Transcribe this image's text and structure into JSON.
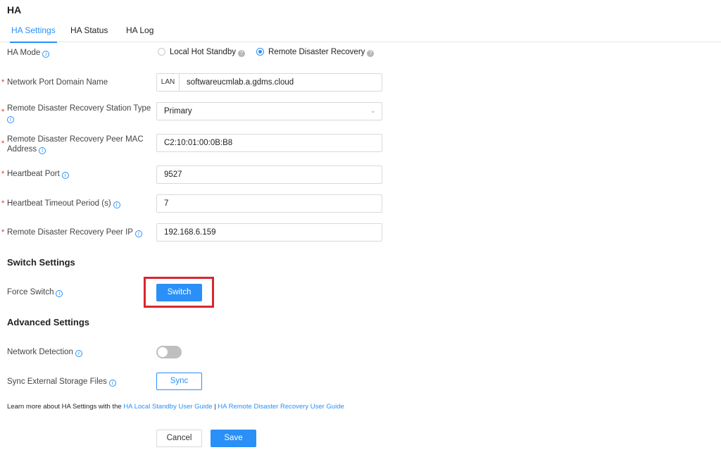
{
  "page": {
    "title": "HA"
  },
  "tabs": [
    {
      "label": "HA Settings",
      "active": true
    },
    {
      "label": "HA Status",
      "active": false
    },
    {
      "label": "HA Log",
      "active": false
    }
  ],
  "ha_mode": {
    "label": "HA Mode",
    "options": [
      {
        "label": "Local Hot Standby",
        "checked": false
      },
      {
        "label": "Remote Disaster Recovery",
        "checked": true
      }
    ]
  },
  "fields": {
    "domain_name": {
      "label": "Network Port Domain Name",
      "addon": "LAN",
      "value": "softwareucmlab.a.gdms.cloud"
    },
    "station_type": {
      "label": "Remote Disaster Recovery Station Type",
      "value": "Primary"
    },
    "peer_mac": {
      "label_line1": "Remote Disaster Recovery Peer MAC",
      "label_line2": "Address",
      "value": "C2:10:01:00:0B:B8"
    },
    "heartbeat_port": {
      "label": "Heartbeat Port",
      "value": "9527"
    },
    "heartbeat_timeout": {
      "label": "Heartbeat Timeout Period (s)",
      "value": "7"
    },
    "peer_ip": {
      "label": "Remote Disaster Recovery Peer IP",
      "value": "192.168.6.159"
    }
  },
  "switch_settings": {
    "title": "Switch Settings",
    "force_switch_label": "Force Switch",
    "switch_button": "Switch"
  },
  "advanced_settings": {
    "title": "Advanced Settings",
    "network_detection_label": "Network Detection",
    "network_detection_on": false,
    "sync_label": "Sync External Storage Files",
    "sync_button": "Sync"
  },
  "footer": {
    "prefix": "Learn more about HA Settings with the ",
    "link1": "HA Local Standby User Guide",
    "separator": " | ",
    "link2": "HA Remote Disaster Recovery User Guide"
  },
  "actions": {
    "cancel": "Cancel",
    "save": "Save"
  },
  "colors": {
    "accent": "#2a8ff7",
    "required": "#e0302a",
    "highlight": "#d9272e"
  }
}
